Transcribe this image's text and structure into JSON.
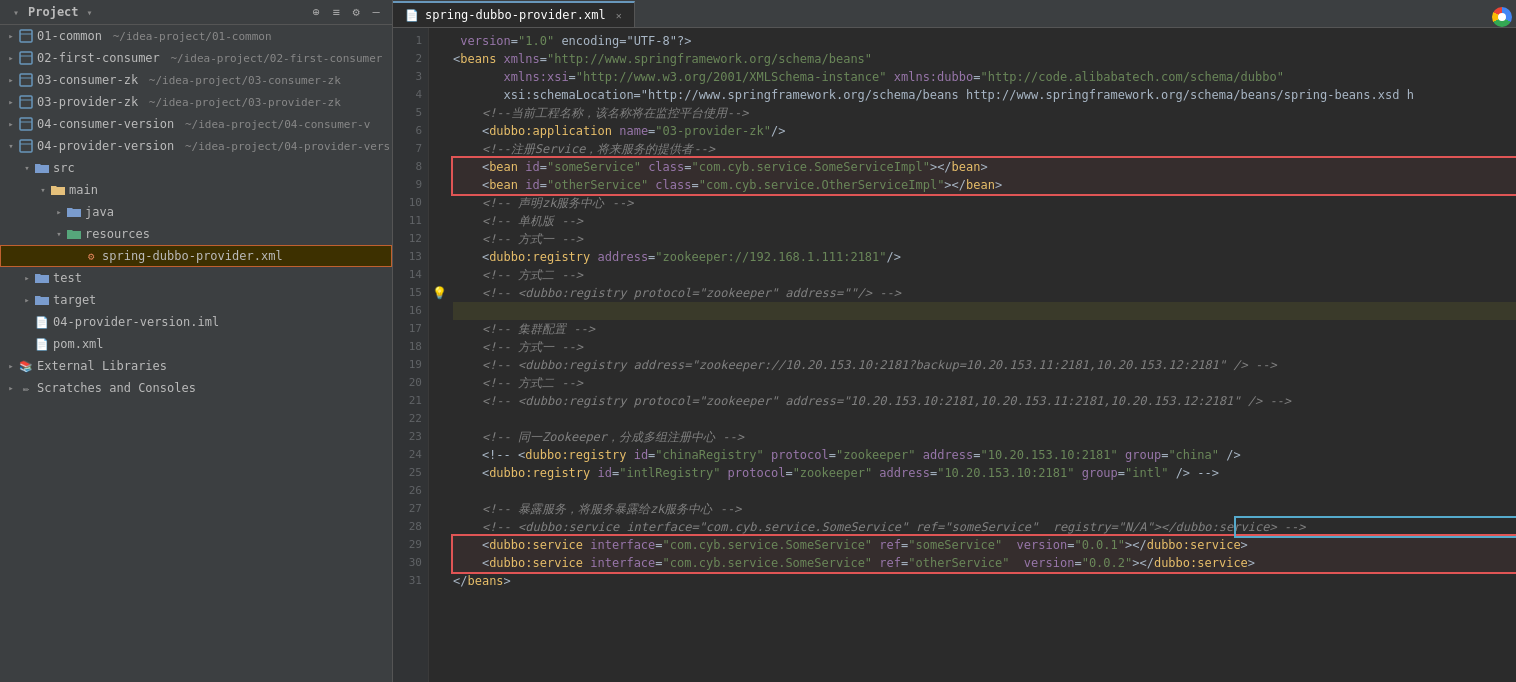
{
  "window": {
    "title": "Project"
  },
  "sidebar": {
    "title": "Project",
    "items": [
      {
        "id": "01-common",
        "label": "01-common",
        "path": "~/idea-project/01-common",
        "level": 0,
        "type": "module",
        "hasArrow": true,
        "expanded": false
      },
      {
        "id": "02-first-consumer",
        "label": "02-first-consumer",
        "path": "~/idea-project/02-first-consumer",
        "level": 0,
        "type": "module",
        "hasArrow": true,
        "expanded": false
      },
      {
        "id": "03-consumer-zk",
        "label": "03-consumer-zk",
        "path": "~/idea-project/03-consumer-zk",
        "level": 0,
        "type": "module",
        "hasArrow": true,
        "expanded": false
      },
      {
        "id": "03-provider-zk",
        "label": "03-provider-zk",
        "path": "~/idea-project/03-provider-zk",
        "level": 0,
        "type": "module",
        "hasArrow": true,
        "expanded": false
      },
      {
        "id": "04-consumer-version",
        "label": "04-consumer-version",
        "path": "~/idea-project/04-consumer-v",
        "level": 0,
        "type": "module",
        "hasArrow": true,
        "expanded": false
      },
      {
        "id": "04-provider-version",
        "label": "04-provider-version",
        "path": "~/idea-project/04-provider-vers",
        "level": 0,
        "type": "module",
        "hasArrow": true,
        "expanded": true
      },
      {
        "id": "src",
        "label": "src",
        "level": 1,
        "type": "folder",
        "hasArrow": true,
        "expanded": true
      },
      {
        "id": "main",
        "label": "main",
        "level": 2,
        "type": "folder-src",
        "hasArrow": true,
        "expanded": true
      },
      {
        "id": "java",
        "label": "java",
        "level": 3,
        "type": "folder",
        "hasArrow": true,
        "expanded": false
      },
      {
        "id": "resources",
        "label": "resources",
        "level": 3,
        "type": "folder-res",
        "hasArrow": true,
        "expanded": true
      },
      {
        "id": "spring-dubbo-provider-xml",
        "label": "spring-dubbo-provider.xml",
        "level": 4,
        "type": "xml",
        "hasArrow": false,
        "expanded": false,
        "selected": true
      },
      {
        "id": "test",
        "label": "test",
        "level": 1,
        "type": "folder",
        "hasArrow": true,
        "expanded": false
      },
      {
        "id": "target",
        "label": "target",
        "level": 1,
        "type": "folder",
        "hasArrow": true,
        "expanded": false
      },
      {
        "id": "04-provider-version-iml",
        "label": "04-provider-version.iml",
        "level": 1,
        "type": "iml",
        "hasArrow": false
      },
      {
        "id": "pom-xml",
        "label": "pom.xml",
        "level": 1,
        "type": "pom",
        "hasArrow": false
      },
      {
        "id": "external-libraries",
        "label": "External Libraries",
        "level": 0,
        "type": "external",
        "hasArrow": true,
        "expanded": false
      },
      {
        "id": "scratches-consoles",
        "label": "Scratches and Consoles",
        "level": 0,
        "type": "scratch",
        "hasArrow": true,
        "expanded": false
      }
    ]
  },
  "editor": {
    "tab": "spring-dubbo-provider.xml",
    "lines": [
      {
        "n": 1,
        "content": "<?xml version=\"1.0\" encoding=\"UTF-8\"?>",
        "type": "pi"
      },
      {
        "n": 2,
        "content": "<beans xmlns=\"http://www.springframework.org/schema/beans\"",
        "type": "tag"
      },
      {
        "n": 3,
        "content": "       xmlns:xsi=\"http://www.w3.org/2001/XMLSchema-instance\" xmlns:dubbo=\"http://code.alibabatech.com/schema/dubbo\"",
        "type": "attr"
      },
      {
        "n": 4,
        "content": "       xsi:schemaLocation=\"http://www.springframework.org/schema/beans http://www.springframework.org/schema/beans/spring-beans.xsd h",
        "type": "attr"
      },
      {
        "n": 5,
        "content": "    <!--当前工程名称，该名称将在监控平台使用-->",
        "type": "comment"
      },
      {
        "n": 6,
        "content": "    <dubbo:application name=\"03-provider-zk\"/>",
        "type": "tag"
      },
      {
        "n": 7,
        "content": "    <!--注册Service，将来服务的提供者-->",
        "type": "comment"
      },
      {
        "n": 8,
        "content": "    <bean id=\"someService\" class=\"com.cyb.service.SomeServiceImpl\"></bean>",
        "type": "tag",
        "highlight": "red"
      },
      {
        "n": 9,
        "content": "    <bean id=\"otherService\" class=\"com.cyb.service.OtherServiceImpl\"></bean>",
        "type": "tag",
        "highlight": "red"
      },
      {
        "n": 10,
        "content": "    <!-- 声明zk服务中心 -->",
        "type": "comment"
      },
      {
        "n": 11,
        "content": "    <!-- 单机版 -->",
        "type": "comment"
      },
      {
        "n": 12,
        "content": "    <!-- 方式一 -->",
        "type": "comment"
      },
      {
        "n": 13,
        "content": "    <dubbo:registry address=\"zookeeper://192.168.1.111:2181\"/>",
        "type": "tag"
      },
      {
        "n": 14,
        "content": "    <!-- 方式二 -->",
        "type": "comment"
      },
      {
        "n": 15,
        "content": "    <!-- <dubbo:registry protocol=\"zookeeper\" address=\"\"/> -->",
        "type": "comment",
        "hasLightbulb": true
      },
      {
        "n": 16,
        "content": "",
        "type": "empty",
        "highlight": "yellow"
      },
      {
        "n": 17,
        "content": "    <!-- 集群配置 -->",
        "type": "comment"
      },
      {
        "n": 18,
        "content": "    <!-- 方式一 -->",
        "type": "comment"
      },
      {
        "n": 19,
        "content": "    <!-- <dubbo:registry address=\"zookeeper://10.20.153.10:2181?backup=10.20.153.11:2181,10.20.153.12:2181\" /> -->",
        "type": "comment"
      },
      {
        "n": 20,
        "content": "    <!-- 方式二 -->",
        "type": "comment"
      },
      {
        "n": 21,
        "content": "    <!-- <dubbo:registry protocol=\"zookeeper\" address=\"10.20.153.10:2181,10.20.153.11:2181,10.20.153.12:2181\" /> -->",
        "type": "comment"
      },
      {
        "n": 22,
        "content": "",
        "type": "empty"
      },
      {
        "n": 23,
        "content": "    <!-- 同一Zookeeper，分成多组注册中心 -->",
        "type": "comment"
      },
      {
        "n": 24,
        "content": "    <!-- <dubbo:registry id=\"chinaRegistry\" protocol=\"zookeeper\" address=\"10.20.153.10:2181\" group=\"china\" />",
        "type": "comment"
      },
      {
        "n": 25,
        "content": "    <dubbo:registry id=\"intlRegistry\" protocol=\"zookeeper\" address=\"10.20.153.10:2181\" group=\"intl\" /> -->",
        "type": "comment"
      },
      {
        "n": 26,
        "content": "",
        "type": "empty"
      },
      {
        "n": 27,
        "content": "    <!-- 暴露服务，将服务暴露给zk服务中心 -->",
        "type": "comment"
      },
      {
        "n": 28,
        "content": "    <!-- <dubbo:service interface=\"com.cyb.service.SomeService\" ref=\"someService\"  registry=\"N/A\"></dubbo:service> -->",
        "type": "comment",
        "highlight": "blue-partial"
      },
      {
        "n": 29,
        "content": "    <dubbo:service interface=\"com.cyb.service.SomeService\" ref=\"someService\"  version=\"0.0.1\"></dubbo:service>",
        "type": "tag",
        "highlight": "red-bottom"
      },
      {
        "n": 30,
        "content": "    <dubbo:service interface=\"com.cyb.service.SomeService\" ref=\"otherService\"  version=\"0.0.2\"></dubbo:service>",
        "type": "tag",
        "highlight": "red-bottom"
      },
      {
        "n": 31,
        "content": "</beans>",
        "type": "tag"
      }
    ]
  }
}
